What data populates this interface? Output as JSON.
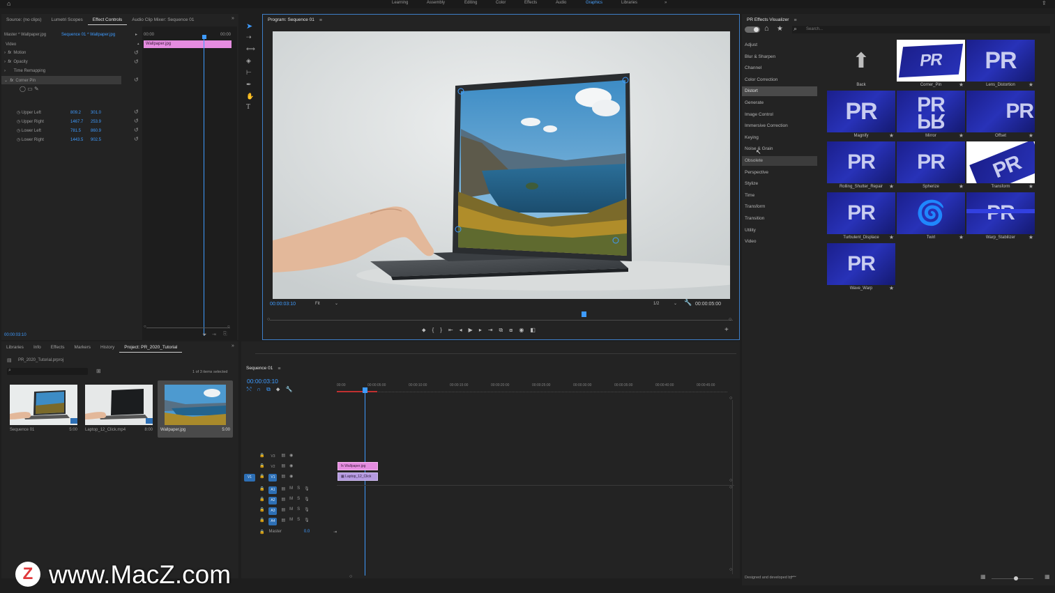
{
  "top_nav": {
    "home_icon": "home-icon",
    "workspaces": [
      "Learning",
      "Assembly",
      "Editing",
      "Color",
      "Effects",
      "Audio",
      "Graphics",
      "Libraries"
    ],
    "active_workspace": "Graphics",
    "more": "»"
  },
  "source_panel": {
    "tabs": [
      "Source: (no clips)",
      "Lumetri Scopes",
      "Effect Controls",
      "Audio Clip Mixer: Sequence 01"
    ],
    "active_tab": "Effect Controls",
    "master_label": "Master * Wallpaper.jpg",
    "sequence_label": "Sequence 01 * Wallpaper.jpg",
    "video_header": "Video",
    "timecode_start": "00:00",
    "timecode_end": "00:00",
    "clip_name": "Wallpaper.jpg",
    "effects": [
      "Motion",
      "Opacity",
      "Time Remapping",
      "Corner Pin"
    ],
    "corner_pin_params": [
      {
        "name": "Upper Left",
        "x": "809.2",
        "y": "301.0"
      },
      {
        "name": "Upper Right",
        "x": "1467.7",
        "y": "253.9"
      },
      {
        "name": "Lower Left",
        "x": "781.5",
        "y": "860.9"
      },
      {
        "name": "Lower Right",
        "x": "1443.5",
        "y": "902.5"
      }
    ],
    "timecode_bottom": "00:00:03:10"
  },
  "program_monitor": {
    "title": "Program: Sequence 01",
    "timecode": "00:00:03:10",
    "fit": "Fit",
    "resolution": "1/2",
    "duration": "00:00:05:00"
  },
  "project_panel": {
    "tabs": [
      "Libraries",
      "Info",
      "Effects",
      "Markers",
      "History",
      "Project: PR_2020_Tutorial"
    ],
    "active_tab": "Project: PR_2020_Tutorial",
    "project_file": "PR_2020_Tutorial.prproj",
    "selection_info": "1 of 3 items selected",
    "items": [
      {
        "name": "Sequence 01",
        "duration": "5:00"
      },
      {
        "name": "Laptop_12_Click.mp4",
        "duration": "8:00"
      },
      {
        "name": "Wallpaper.jpg",
        "duration": "5:00"
      }
    ]
  },
  "timeline": {
    "title": "Sequence 01",
    "timecode": "00:00:03:10",
    "ruler": [
      "00:00",
      "00:00:05:00",
      "00:00:10:00",
      "00:00:15:00",
      "00:00:20:00",
      "00:00:25:00",
      "00:00:30:00",
      "00:00:35:00",
      "00:00:40:00",
      "00:00:45:00"
    ],
    "video_tracks": [
      "V3",
      "V2",
      "V1"
    ],
    "audio_tracks": [
      "A1",
      "A2",
      "A3",
      "A4"
    ],
    "master_label": "Master",
    "master_value": "0.0",
    "clips": [
      {
        "name": "Wallpaper.jpg",
        "track": "V2"
      },
      {
        "name": "Laptop_12_Click",
        "track": "V1"
      }
    ]
  },
  "effects_visualizer": {
    "title": "PR Effects Visualizer",
    "search_placeholder": "Search...",
    "categories": [
      "Adjust",
      "Blur & Sharpen",
      "Channel",
      "Color Correction",
      "Distort",
      "Generate",
      "Image Control",
      "Immersive Correction",
      "Keying",
      "Noise & Grain",
      "Obsolete",
      "Perspective",
      "Stylize",
      "Time",
      "Transform",
      "Transition",
      "Utility",
      "Video"
    ],
    "selected_category": "Distort",
    "hover_category": "Obsolete",
    "effects": [
      "Back",
      "Corner_Pin",
      "Lens_Distortion",
      "Magnify",
      "Mirror",
      "Offset",
      "Rolling_Shutter_Repair",
      "Spherize",
      "Transform",
      "Turbulent_Displace",
      "Twirl",
      "Warp_Stabilizer",
      "Wave_Warp"
    ],
    "footer": "Designed and developed by"
  },
  "watermark": {
    "text": "www.MacZ.com",
    "logo_letter": "Z"
  },
  "colors": {
    "accent_blue": "#3e9bff",
    "clip_pink": "#e58ce0",
    "clip_purple": "#b59ae0",
    "pr_tile": "#2230a8"
  }
}
